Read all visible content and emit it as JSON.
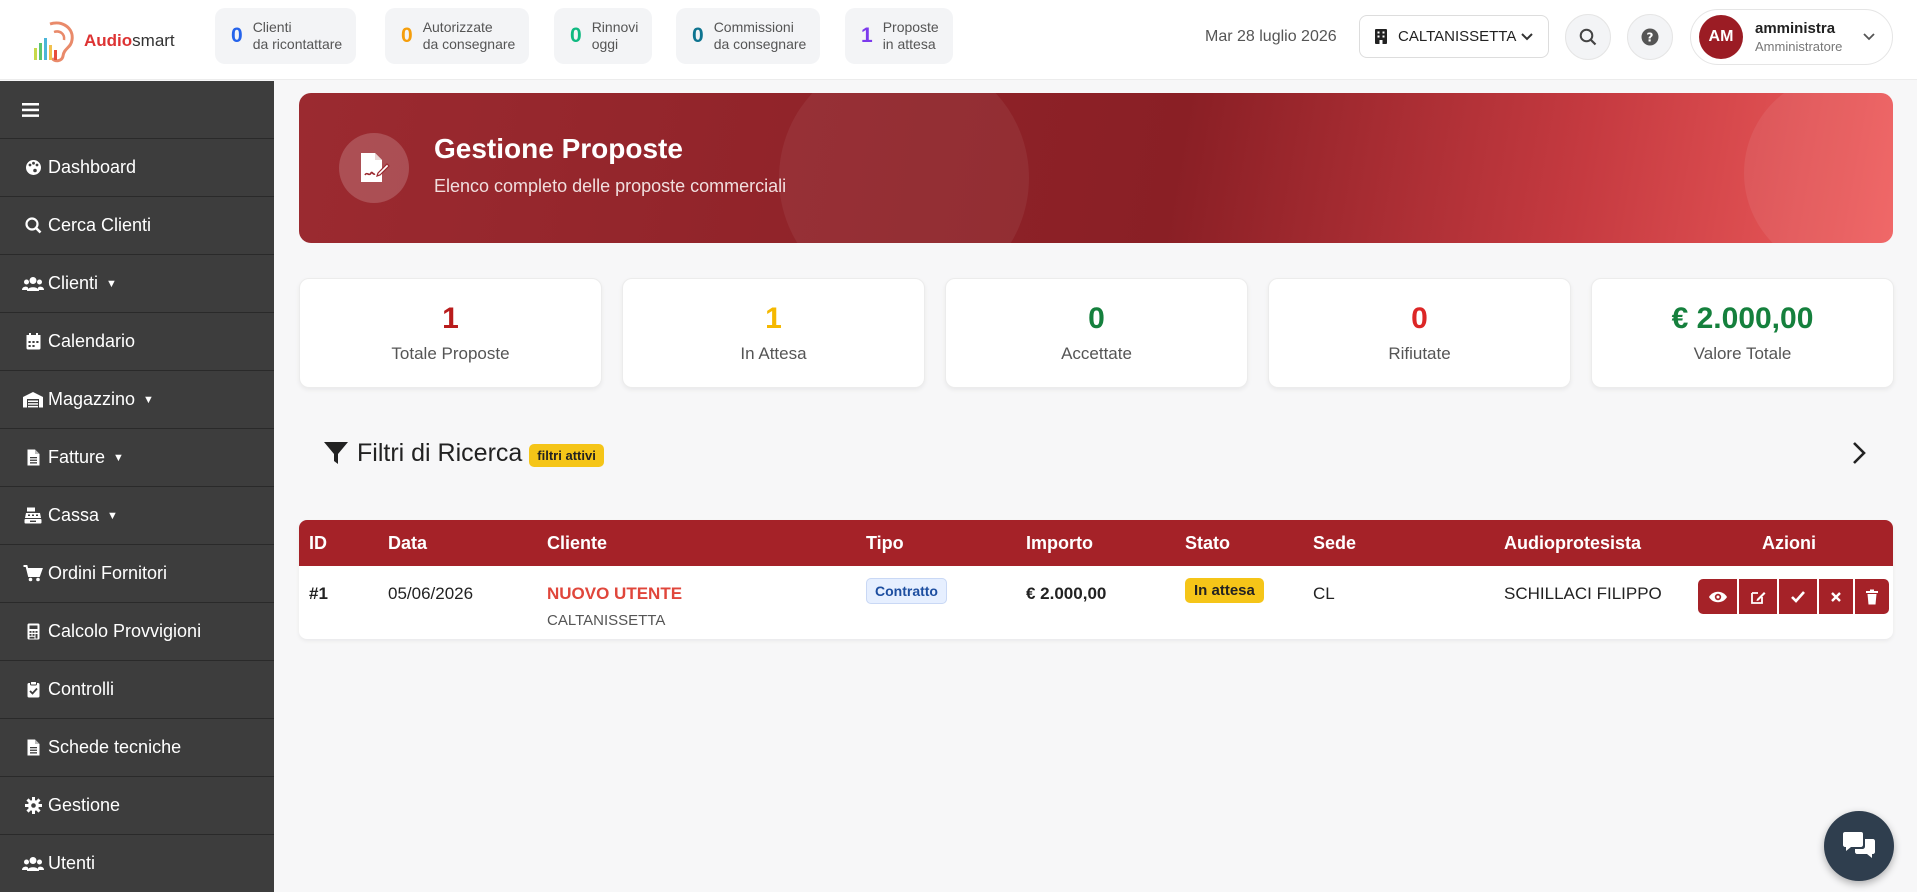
{
  "brand": {
    "name_accent": "Audio",
    "name_rest": "smart"
  },
  "header_stats": [
    {
      "count": "0",
      "line1": "Clienti",
      "line2": "da ricontattare",
      "color": "#2563eb"
    },
    {
      "count": "0",
      "line1": "Autorizzate",
      "line2": "da consegnare",
      "color": "#f59e0b"
    },
    {
      "count": "0",
      "line1": "Rinnovi",
      "line2": "oggi",
      "color": "#10b981"
    },
    {
      "count": "0",
      "line1": "Commissioni",
      "line2": "da consegnare",
      "color": "#0e7490"
    },
    {
      "count": "1",
      "line1": "Proposte",
      "line2": "in attesa",
      "color": "#7c3aed"
    }
  ],
  "header": {
    "date": "Mar 28 luglio 2026",
    "sede": "CALTANISSETTA",
    "user_initials": "AM",
    "user_name": "amministra",
    "user_role": "Amministratore"
  },
  "sidebar": {
    "items": [
      {
        "label": "Dashboard",
        "icon": "palette-icon",
        "has_caret": false
      },
      {
        "label": "Cerca Clienti",
        "icon": "search-icon",
        "has_caret": false
      },
      {
        "label": "Clienti",
        "icon": "users-icon",
        "has_caret": true
      },
      {
        "label": "Calendario",
        "icon": "calendar-icon",
        "has_caret": false
      },
      {
        "label": "Magazzino",
        "icon": "warehouse-icon",
        "has_caret": true
      },
      {
        "label": "Fatture",
        "icon": "file-icon",
        "has_caret": true
      },
      {
        "label": "Cassa",
        "icon": "cash-register-icon",
        "has_caret": true
      },
      {
        "label": "Ordini Fornitori",
        "icon": "cart-icon",
        "has_caret": false
      },
      {
        "label": "Calcolo Provvigioni",
        "icon": "calculator-icon",
        "has_caret": false
      },
      {
        "label": "Controlli",
        "icon": "clipboard-check-icon",
        "has_caret": false
      },
      {
        "label": "Schede tecniche",
        "icon": "file-icon",
        "has_caret": false
      },
      {
        "label": "Gestione",
        "icon": "gear-icon",
        "has_caret": false
      },
      {
        "label": "Utenti",
        "icon": "users-icon",
        "has_caret": false
      }
    ]
  },
  "banner": {
    "title": "Gestione Proposte",
    "subtitle": "Elenco completo delle proposte commerciali"
  },
  "summary_cards": [
    {
      "value": "1",
      "label": "Totale Proposte",
      "color": "#b91c1c"
    },
    {
      "value": "1",
      "label": "In Attesa",
      "color": "#f5b800"
    },
    {
      "value": "0",
      "label": "Accettate",
      "color": "#15803d"
    },
    {
      "value": "0",
      "label": "Rifiutate",
      "color": "#dc2626"
    },
    {
      "value": "€ 2.000,00",
      "label": "Valore Totale",
      "color": "#15803d"
    }
  ],
  "filters": {
    "title": "Filtri di Ricerca",
    "badge": "filtri attivi"
  },
  "table": {
    "columns": [
      "ID",
      "Data",
      "Cliente",
      "Tipo",
      "Importo",
      "Stato",
      "Sede",
      "Audioprotesista",
      "Azioni"
    ],
    "rows": [
      {
        "id": "#1",
        "data": "05/06/2026",
        "cliente": "NUOVO UTENTE",
        "citta": "CALTANISSETTA",
        "tipo": "Contratto",
        "importo": "€ 2.000,00",
        "stato": "In attesa",
        "sede": "CL",
        "audioprotesista": "SCHILLACI FILIPPO"
      }
    ]
  }
}
